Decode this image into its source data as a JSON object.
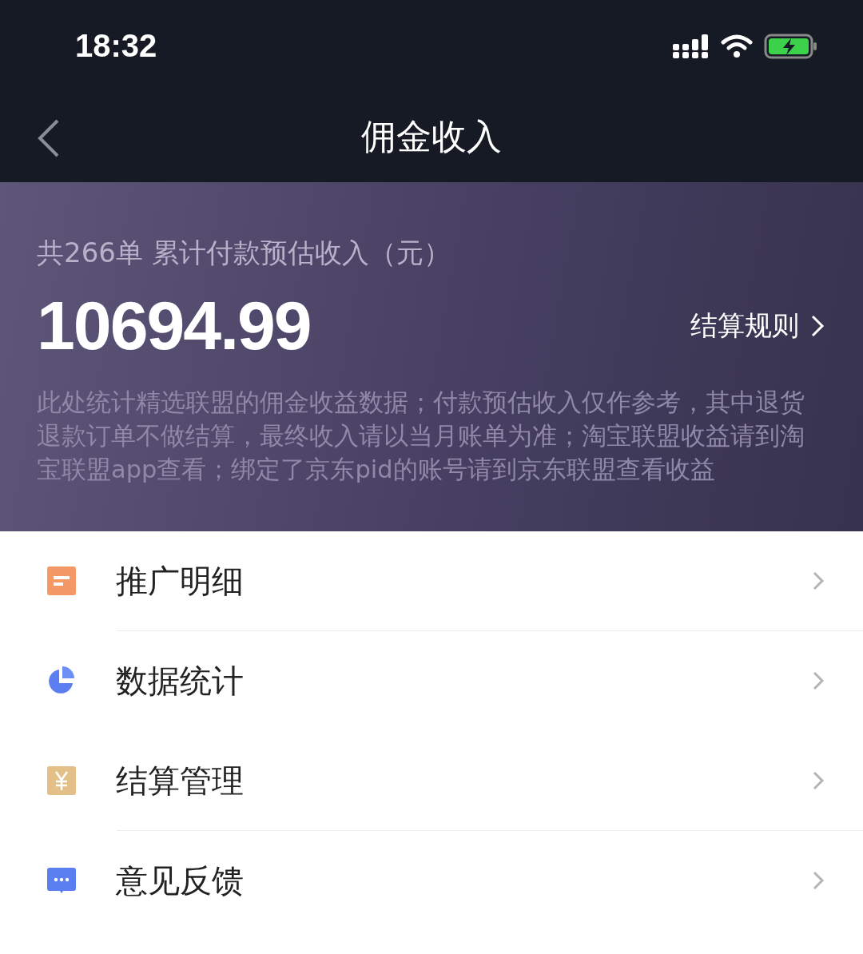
{
  "status_bar": {
    "time": "18:32"
  },
  "nav": {
    "title": "佣金收入"
  },
  "summary": {
    "caption": "共266单 累计付款预估收入（元）",
    "amount": "10694.99",
    "rules_link": "结算规则",
    "note": "此处统计精选联盟的佣金收益数据；付款预估收入仅作参考，其中退货退款订单不做结算，最终收入请以当月账单为准；淘宝联盟收益请到淘宝联盟app查看；绑定了京东pid的账号请到京东联盟查看收益"
  },
  "menu": [
    {
      "kind": "list",
      "label": "推广明细",
      "divider": true
    },
    {
      "kind": "pie",
      "label": "数据统计",
      "divider": false
    },
    {
      "kind": "yen",
      "label": "结算管理",
      "divider": true
    },
    {
      "kind": "chat",
      "label": "意见反馈",
      "divider": false
    }
  ]
}
